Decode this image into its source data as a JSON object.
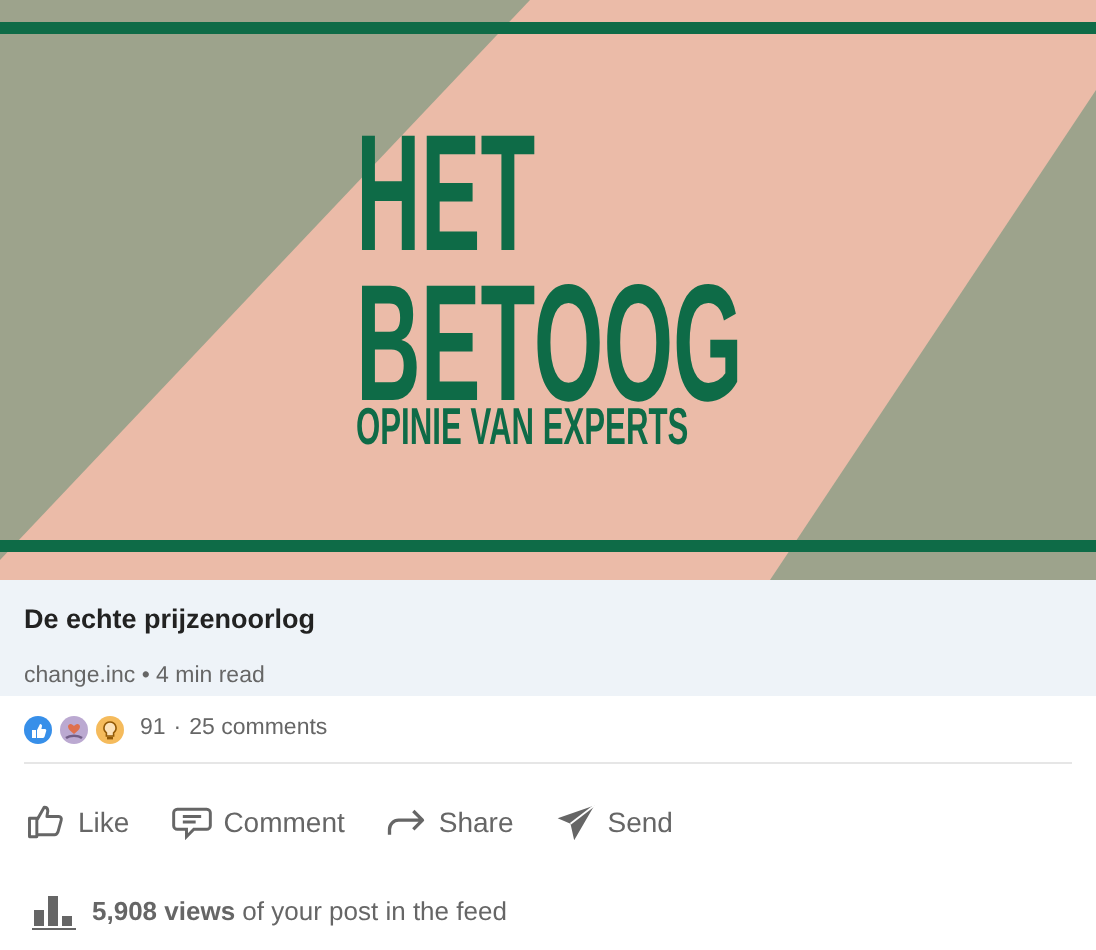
{
  "cover": {
    "title_lines": [
      "HET",
      "BETOOG"
    ],
    "subtitle": "OPINIE VAN EXPERTS"
  },
  "article": {
    "title": "De echte prijzenoorlog",
    "meta": "change.inc • 4 min read"
  },
  "reactions": [
    {
      "kind": "like"
    },
    {
      "kind": "support"
    },
    {
      "kind": "insightful"
    }
  ],
  "reaction_count": "91",
  "separator": "·",
  "comments": "25 comments",
  "actions": [
    {
      "kind": "like",
      "label": "Like"
    },
    {
      "kind": "comment",
      "label": "Comment"
    },
    {
      "kind": "share",
      "label": "Share"
    },
    {
      "kind": "send",
      "label": "Send"
    }
  ],
  "views": "**5,908 views** of your post in the feed"
}
